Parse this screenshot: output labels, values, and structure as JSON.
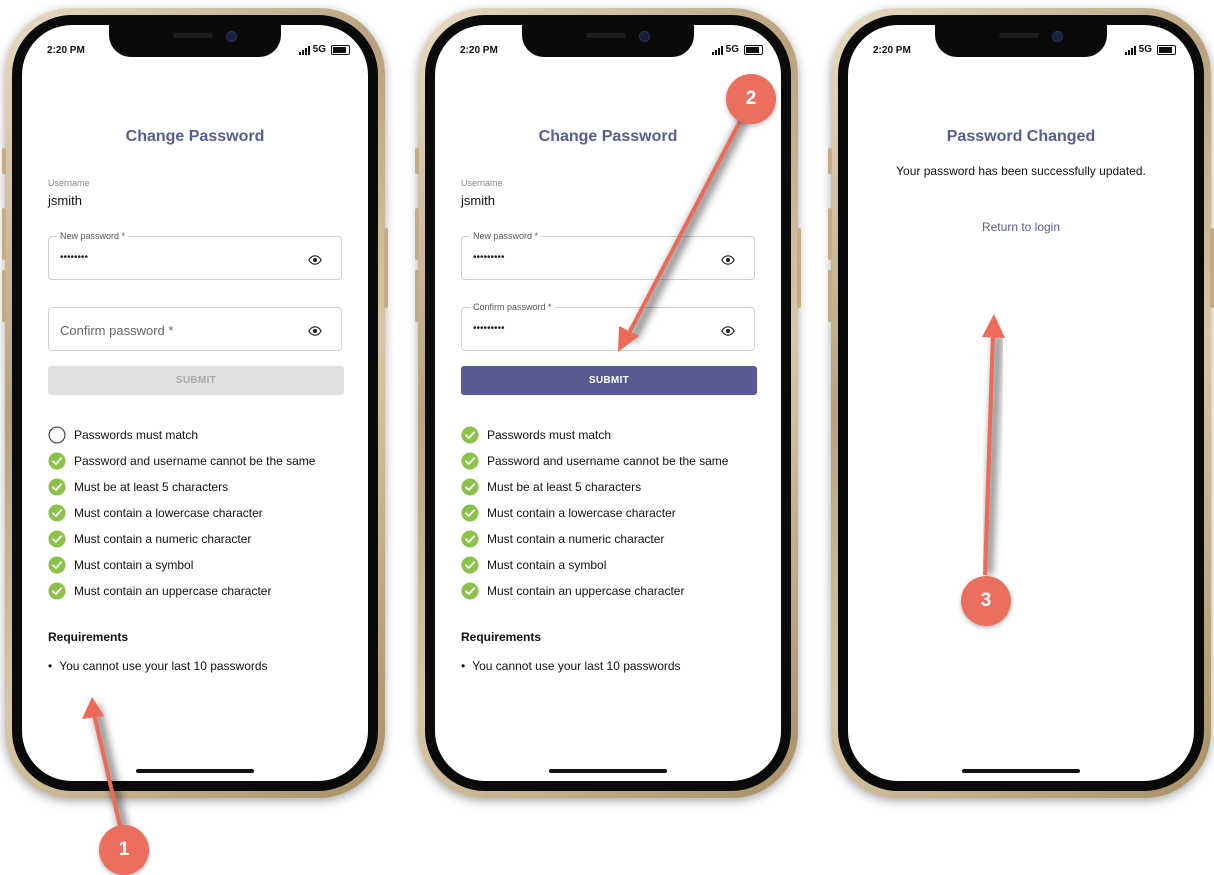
{
  "status": {
    "time": "2:20 PM",
    "network": "5G"
  },
  "phones": [
    {
      "title": "Change Password",
      "username_label": "Username",
      "username": "jsmith",
      "new_password_label": "New password *",
      "new_password_value": "••••••••",
      "confirm_placeholder": "Confirm password *",
      "submit_label": "SUBMIT",
      "rules": [
        {
          "text": "Passwords must match",
          "met": false
        },
        {
          "text": "Password and username cannot be the same",
          "met": true
        },
        {
          "text": "Must be at least 5 characters",
          "met": true
        },
        {
          "text": "Must contain a lowercase character",
          "met": true
        },
        {
          "text": "Must contain a numeric character",
          "met": true
        },
        {
          "text": "Must contain a symbol",
          "met": true
        },
        {
          "text": "Must contain an uppercase character",
          "met": true
        }
      ],
      "requirements_title": "Requirements",
      "requirements": [
        "You cannot use your last 10 passwords"
      ]
    },
    {
      "title": "Change Password",
      "username_label": "Username",
      "username": "jsmith",
      "new_password_label": "New password *",
      "new_password_value": "•••••••••",
      "confirm_label": "Confirm password *",
      "confirm_value": "•••••••••",
      "submit_label": "SUBMIT",
      "rules": [
        {
          "text": "Passwords must match",
          "met": true
        },
        {
          "text": "Password and username cannot be the same",
          "met": true
        },
        {
          "text": "Must be at least 5 characters",
          "met": true
        },
        {
          "text": "Must contain a lowercase character",
          "met": true
        },
        {
          "text": "Must contain a numeric character",
          "met": true
        },
        {
          "text": "Must contain a symbol",
          "met": true
        },
        {
          "text": "Must contain an uppercase character",
          "met": true
        }
      ],
      "requirements_title": "Requirements",
      "requirements": [
        "You cannot use your last 10 passwords"
      ]
    },
    {
      "title": "Password Changed",
      "message": "Your password has been successfully updated.",
      "return_link": "Return to login"
    }
  ],
  "annotations": {
    "step1": "1",
    "step2": "2",
    "step3": "3"
  },
  "colors": {
    "accent": "#575b91",
    "check": "#8bc34a",
    "badge": "#ea6f5f",
    "arrow": "#ec6a58"
  }
}
